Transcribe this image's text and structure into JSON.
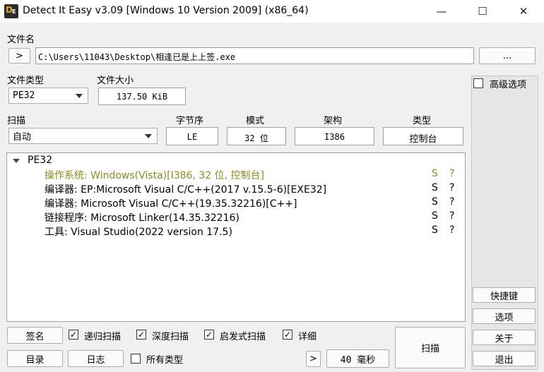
{
  "window": {
    "title": "Detect It Easy v3.09 [Windows 10 Version 2009] (x86_64)",
    "minimize": "—",
    "maximize": "☐",
    "close": "✕"
  },
  "file": {
    "label": "文件名",
    "open_button": ">",
    "path": "C:\\Users\\11043\\Desktop\\相逢已是上上签.exe",
    "browse_button": "..."
  },
  "filetype": {
    "label": "文件类型",
    "value": "PE32"
  },
  "filesize": {
    "label": "文件大小",
    "value": "137.50 KiB"
  },
  "scan": {
    "label": "扫描",
    "value": "自动"
  },
  "endian": {
    "label": "字节序",
    "value": "LE"
  },
  "mode": {
    "label": "模式",
    "value": "32 位"
  },
  "arch": {
    "label": "架构",
    "value": "I386"
  },
  "type": {
    "label": "类型",
    "value": "控制台"
  },
  "results": {
    "root": "PE32",
    "rows": [
      {
        "text": "操作系统: Windows(Vista)[I386, 32 位, 控制台]",
        "s": "S",
        "q": "?",
        "highlight": true
      },
      {
        "text": "编译器: EP:Microsoft Visual C/C++(2017 v.15.5-6)[EXE32]",
        "s": "S",
        "q": "?",
        "highlight": false
      },
      {
        "text": "编译器: Microsoft Visual C/C++(19.35.32216)[C++]",
        "s": "S",
        "q": "?",
        "highlight": false
      },
      {
        "text": "链接程序: Microsoft Linker(14.35.32216)",
        "s": "S",
        "q": "?",
        "highlight": false
      },
      {
        "text": "工具: Visual Studio(2022 version 17.5)",
        "s": "S",
        "q": "?",
        "highlight": false
      }
    ]
  },
  "options": {
    "advanced": {
      "label": "高级选项",
      "checked": false
    },
    "recursive": {
      "label": "递归扫描",
      "checked": true
    },
    "deep": {
      "label": "深度扫描",
      "checked": true
    },
    "heuristic": {
      "label": "启发式扫描",
      "checked": true
    },
    "verbose": {
      "label": "详细",
      "checked": true
    },
    "all_types": {
      "label": "所有类型",
      "checked": false
    }
  },
  "buttons": {
    "signatures": "签名",
    "directory": "目录",
    "log": "日志",
    "next": ">",
    "time": "40 毫秒",
    "scan": "扫描",
    "shortcuts": "快捷键",
    "options": "选项",
    "about": "关于",
    "exit": "退出"
  },
  "colors": {
    "highlight": "#8b8b1f"
  }
}
